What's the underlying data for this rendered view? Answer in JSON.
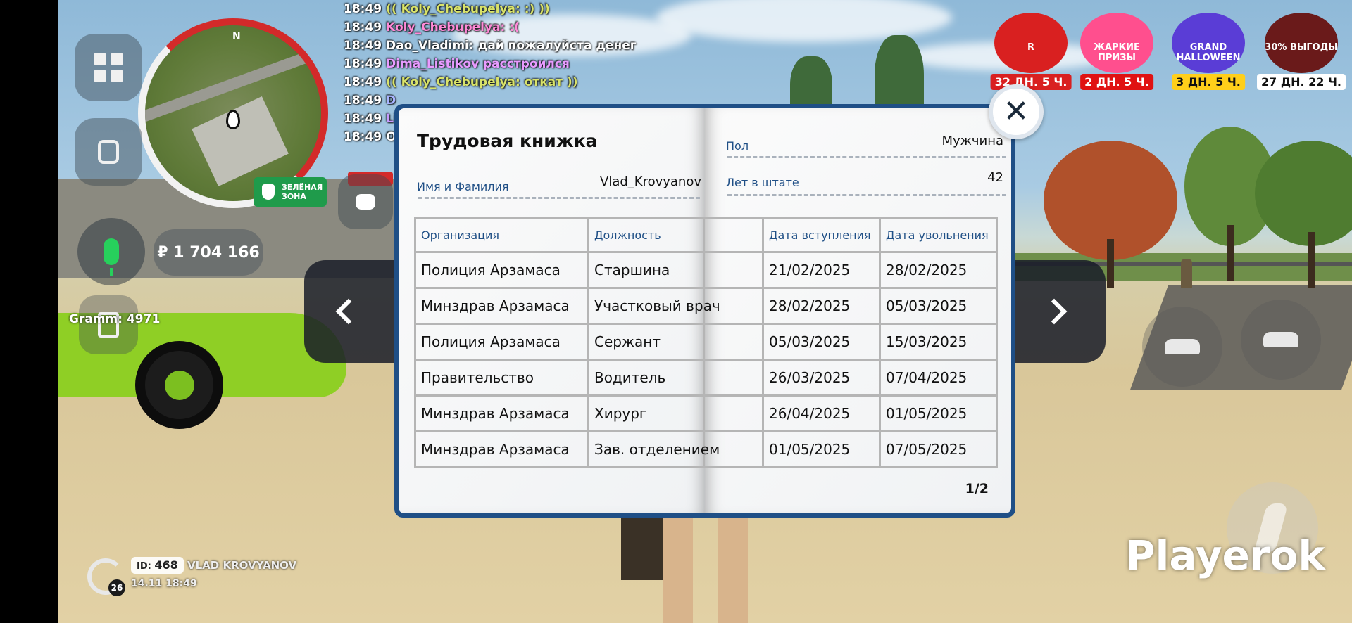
{
  "chat": [
    {
      "time": "18:49",
      "text": "(( Koly_Chebupelya: :) ))",
      "color": "#d9e36a"
    },
    {
      "time": "18:49",
      "text": "Koly_Chebupelya: :(",
      "color": "#ff8ad8"
    },
    {
      "time": "18:49",
      "text": "Dao_Vladimi: дай пожалуйста денег",
      "color": "#ffffff"
    },
    {
      "time": "18:49",
      "text": "Dima_Listikov расстроился",
      "color": "#e89bff"
    },
    {
      "time": "18:49",
      "text": "(( Koly_Chebupelya: откат ))",
      "color": "#d9e36a"
    },
    {
      "time": "18:49",
      "text": "D",
      "color": "#a8b4ff"
    },
    {
      "time": "18:49",
      "text": "Li",
      "color": "#c89bff"
    },
    {
      "time": "18:49",
      "text": "O",
      "color": "#ffffff"
    }
  ],
  "hud": {
    "zone_label": "ЗЕЛЁНАЯ ЗОНА",
    "money": "₽ 1 704 166",
    "gramm": "Gramm: 4971",
    "north": "N",
    "watermark": "Playerok",
    "player": {
      "id_label": "ID:",
      "id": "468",
      "nick": "VLAD KROVYANOV",
      "datetime": "14.11 18:49",
      "level": "26"
    }
  },
  "events": [
    {
      "name": "r-event",
      "label": "32 ДН. 5 Ч.",
      "inner": "R",
      "pic_color": "#d92020",
      "label_bg": "#d92020",
      "label_fg": "#ffffff"
    },
    {
      "name": "hot-prizes",
      "label": "2 ДН. 5 Ч.",
      "inner": "ЖАРКИЕ ПРИЗЫ",
      "pic_color": "#ff4f8e",
      "label_bg": "#e01212",
      "label_fg": "#ffffff"
    },
    {
      "name": "grand-halloween",
      "label": "3 ДН. 5 Ч.",
      "inner": "GRAND HALLOWEEN",
      "pic_color": "#5a3dd6",
      "label_bg": "#ffcf1a",
      "label_fg": "#111111"
    },
    {
      "name": "sale",
      "label": "27 ДН. 22 Ч.",
      "inner": "30% ВЫГОДЫ",
      "pic_color": "#6a1a1a",
      "label_bg": "#ffffff",
      "label_fg": "#111111"
    }
  ],
  "book": {
    "title": "Трудовая книжка",
    "name_label": "Имя и Фамилия",
    "name_value": "Vlad_Krovyanov",
    "gender_label": "Пол",
    "gender_value": "Мужчина",
    "years_label": "Лет в штате",
    "years_value": "42",
    "columns": [
      "Организация",
      "Должность",
      "",
      "Дата вступления",
      "Дата увольнения"
    ],
    "rows": [
      [
        "Полиция Арзамаса",
        "Старшина",
        "",
        "21/02/2025",
        "28/02/2025"
      ],
      [
        "Минздрав Арзамаса",
        "Участковый врач",
        "",
        "28/02/2025",
        "05/03/2025"
      ],
      [
        "Полиция Арзамаса",
        "Сержант",
        "",
        "05/03/2025",
        "15/03/2025"
      ],
      [
        "Правительство",
        "Водитель",
        "",
        "26/03/2025",
        "07/04/2025"
      ],
      [
        "Минздрав Арзамаса",
        "Хирург",
        "",
        "26/04/2025",
        "01/05/2025"
      ],
      [
        "Минздрав Арзамаса",
        "Зав. отделением",
        "",
        "01/05/2025",
        "07/05/2025"
      ]
    ],
    "page": "1/2",
    "close": "✕"
  }
}
